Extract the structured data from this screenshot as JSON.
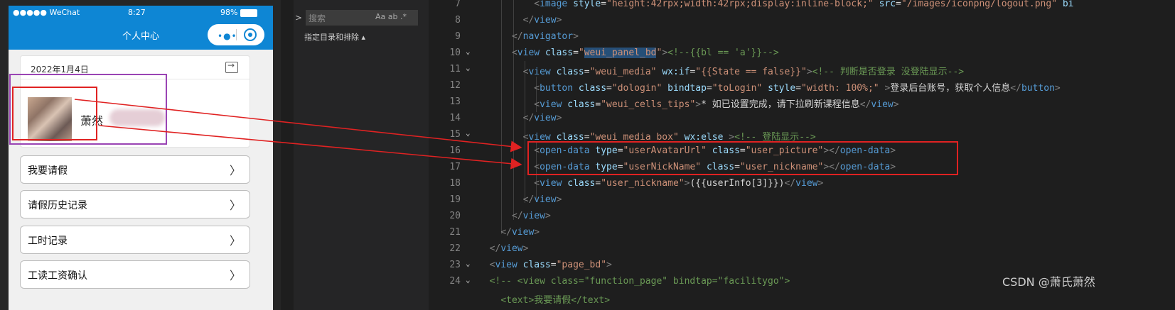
{
  "phone": {
    "status": {
      "carrier": "●●●●● WeChat",
      "time": "8:27",
      "battery": "98%"
    },
    "nav_title": "个人中心",
    "card": {
      "date": "2022年1月4日",
      "nickname": "萧然"
    },
    "menu": [
      {
        "label": "我要请假",
        "arrow": "〉"
      },
      {
        "label": "请假历史记录",
        "arrow": "〉"
      },
      {
        "label": "工时记录",
        "arrow": "〉"
      },
      {
        "label": "工读工资确认",
        "arrow": "〉"
      }
    ]
  },
  "sidebar": {
    "search_placeholder": "搜索",
    "search_options": "Aa ab .*",
    "dir_label": "指定目录和排除 ▴"
  },
  "code": {
    "lines": [
      {
        "n": "7",
        "fold": "",
        "html": "          <span class='t'>&lt;</span><span class='tag'>image</span> <span class='attr'>style</span><span class='txt'>=</span><span class='str'>\"height:42rpx;width:42rpx;display:inline-block;\"</span> <span class='attr'>src</span><span class='txt'>=</span><span class='str'>\"/images/iconpng/logout.png\"</span> <span class='attr'>bi</span>"
      },
      {
        "n": "8",
        "fold": "",
        "html": "        <span class='t'>&lt;/</span><span class='tag'>view</span><span class='t'>&gt;</span>"
      },
      {
        "n": "9",
        "fold": "",
        "html": "      <span class='t'>&lt;/</span><span class='tag'>navigator</span><span class='t'>&gt;</span>"
      },
      {
        "n": "10",
        "fold": "v",
        "html": "      <span class='t'>&lt;</span><span class='tag'>view</span> <span class='attr'>class</span><span class='txt'>=</span><span class='str'>\"<span class='hl'>weui_panel_bd</span>\"</span><span class='t'>&gt;</span><span class='cmt'>&lt;!--{{bl == 'a'}}--&gt;</span>"
      },
      {
        "n": "11",
        "fold": "v",
        "html": "        <span class='t'>&lt;</span><span class='tag'>view</span> <span class='attr'>class</span><span class='txt'>=</span><span class='str'>\"weui_media\"</span> <span class='attr'>wx:if</span><span class='txt'>=</span><span class='str'>\"{{State == false}}\"</span><span class='t'>&gt;</span><span class='cmt'>&lt;!-- 判断是否登录 没登陆显示--&gt;</span>"
      },
      {
        "n": "12",
        "fold": "",
        "html": "          <span class='t'>&lt;</span><span class='tag'>button</span> <span class='attr'>class</span><span class='txt'>=</span><span class='str'>\"dologin\"</span> <span class='attr'>bindtap</span><span class='txt'>=</span><span class='str'>\"toLogin\"</span> <span class='attr'>style</span><span class='txt'>=</span><span class='str'>\"width: 100%;\"</span> <span class='t'>&gt;</span><span class='txt'>登录后台账号，获取个人信息</span><span class='t'>&lt;/</span><span class='tag'>button</span><span class='t'>&gt;</span>"
      },
      {
        "n": "13",
        "fold": "",
        "html": "          <span class='t'>&lt;</span><span class='tag'>view</span> <span class='attr'>class</span><span class='txt'>=</span><span class='str'>\"weui_cells_tips\"</span><span class='t'>&gt;</span><span class='txt'>* 如已设置完成，请下拉刷新课程信息</span><span class='t'>&lt;/</span><span class='tag'>view</span><span class='t'>&gt;</span>"
      },
      {
        "n": "14",
        "fold": "",
        "html": "        <span class='t'>&lt;/</span><span class='tag'>view</span><span class='t'>&gt;</span>"
      },
      {
        "n": "15",
        "fold": "v",
        "html": "        <span class='t'>&lt;</span><span class='tag'>view</span> <span class='attr'>class</span><span class='txt'>=</span><span class='str'>\"weui_media_box\"</span> <span class='attr'>wx:else</span> <span class='t'>&gt;</span><span class='cmt'>&lt;!-- 登陆显示--&gt;</span>"
      },
      {
        "n": "16",
        "fold": "",
        "html": "          <span class='t'>&lt;</span><span class='tag'>open-data</span> <span class='attr'>type</span><span class='txt'>=</span><span class='str'>\"userAvatarUrl\"</span> <span class='attr'>class</span><span class='txt'>=</span><span class='str'>\"user_picture\"</span><span class='t'>&gt;&lt;/</span><span class='tag'>open-data</span><span class='t'>&gt;</span>"
      },
      {
        "n": "17",
        "fold": "",
        "html": "          <span class='t'>&lt;</span><span class='tag'>open-data</span> <span class='attr'>type</span><span class='txt'>=</span><span class='str'>\"userNickName\"</span> <span class='attr'>class</span><span class='txt'>=</span><span class='str'>\"user_nickname\"</span><span class='t'>&gt;&lt;/</span><span class='tag'>open-data</span><span class='t'>&gt;</span>"
      },
      {
        "n": "18",
        "fold": "",
        "html": "          <span class='t'>&lt;</span><span class='tag'>view</span> <span class='attr'>class</span><span class='txt'>=</span><span class='str'>\"user_nickname\"</span><span class='t'>&gt;</span><span class='txt'>({{userInfo[3]}})</span><span class='t'>&lt;/</span><span class='tag'>view</span><span class='t'>&gt;</span>"
      },
      {
        "n": "19",
        "fold": "",
        "html": "        <span class='t'>&lt;/</span><span class='tag'>view</span><span class='t'>&gt;</span>"
      },
      {
        "n": "20",
        "fold": "",
        "html": "      <span class='t'>&lt;/</span><span class='tag'>view</span><span class='t'>&gt;</span>"
      },
      {
        "n": "21",
        "fold": "",
        "html": "    <span class='t'>&lt;/</span><span class='tag'>view</span><span class='t'>&gt;</span>"
      },
      {
        "n": "22",
        "fold": "",
        "html": "  <span class='t'>&lt;/</span><span class='tag'>view</span><span class='t'>&gt;</span>"
      },
      {
        "n": "23",
        "fold": "v",
        "html": "  <span class='t'>&lt;</span><span class='tag'>view</span> <span class='attr'>class</span><span class='txt'>=</span><span class='str'>\"page_bd\"</span><span class='t'>&gt;</span>"
      },
      {
        "n": "24",
        "fold": "v",
        "html": "  <span class='cmt'>&lt;!-- &lt;view class=\"function_page\" bindtap=\"facilitygo\"&gt;</span>"
      },
      {
        "n": "",
        "fold": "",
        "html": "    <span class='cmt'>&lt;text&gt;我要请假&lt;/text&gt;</span>"
      }
    ]
  },
  "watermark": "CSDN @萧氏萧然",
  "colors": {
    "wechat_blue": "#0e86d4",
    "annotation_red": "#e02222",
    "annotation_purple": "#9a44b4"
  }
}
